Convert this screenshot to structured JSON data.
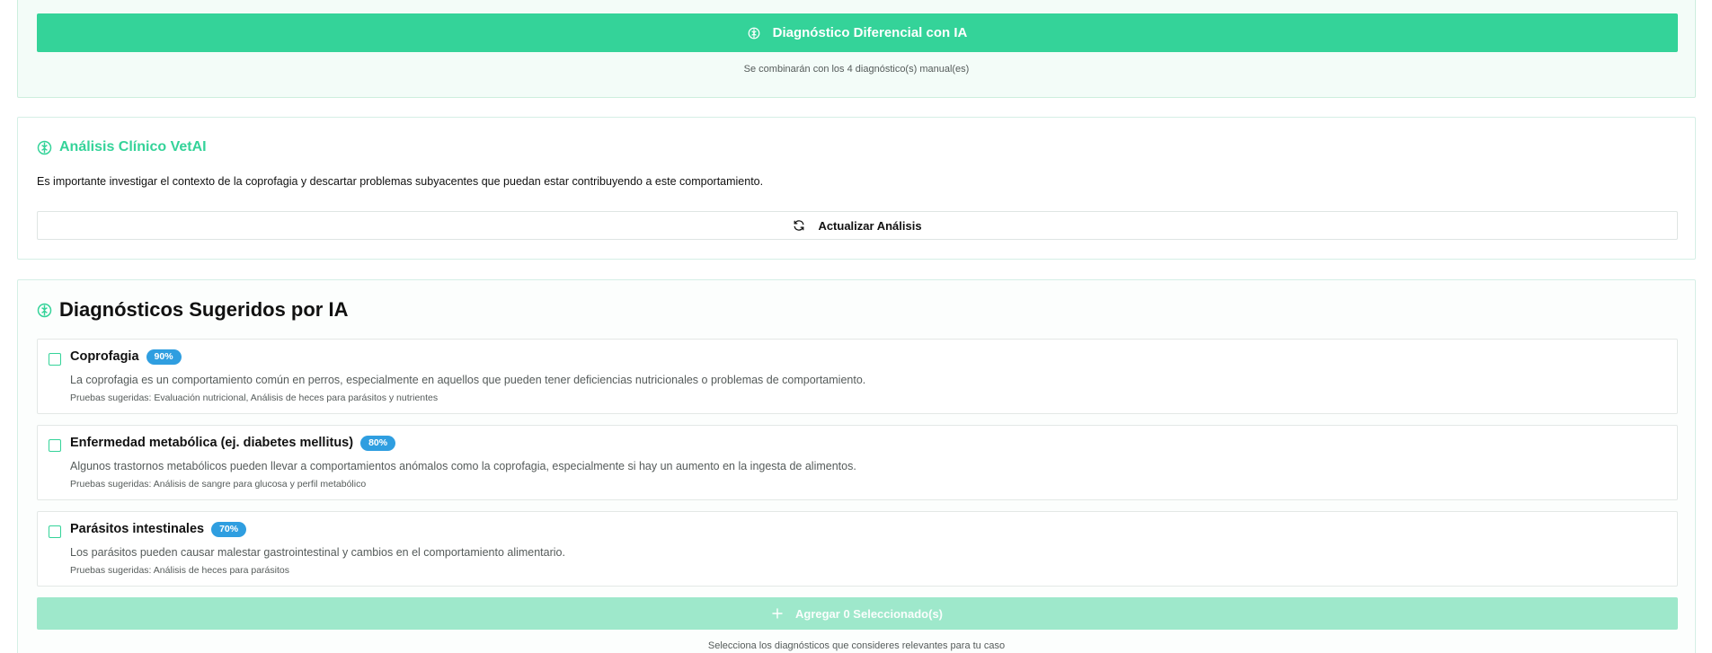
{
  "differential": {
    "button_label": "Diagnóstico Diferencial con IA",
    "hint": "Se combinarán con los 4 diagnóstico(s) manual(es)"
  },
  "analysis": {
    "title": "Análisis Clínico VetAI",
    "text": "Es importante investigar el contexto de la coprofagia y descartar problemas subyacentes que puedan estar contribuyendo a este comportamiento.",
    "update_label": "Actualizar Análisis"
  },
  "suggestions": {
    "title": "Diagnósticos Sugeridos por IA",
    "items": [
      {
        "name": "Coprofagia",
        "confidence": "90%",
        "description": "La coprofagia es un comportamiento común en perros, especialmente en aquellos que pueden tener deficiencias nutricionales o problemas de comportamiento.",
        "tests": "Pruebas sugeridas: Evaluación nutricional, Análisis de heces para parásitos y nutrientes",
        "checked": false
      },
      {
        "name": "Enfermedad metabólica (ej. diabetes mellitus)",
        "confidence": "80%",
        "description": "Algunos trastornos metabólicos pueden llevar a comportamientos anómalos como la coprofagia, especialmente si hay un aumento en la ingesta de alimentos.",
        "tests": "Pruebas sugeridas: Análisis de sangre para glucosa y perfil metabólico",
        "checked": false
      },
      {
        "name": "Parásitos intestinales",
        "confidence": "70%",
        "description": "Los parásitos pueden causar malestar gastrointestinal y cambios en el comportamiento alimentario.",
        "tests": "Pruebas sugeridas: Análisis de heces para parásitos",
        "checked": false
      }
    ],
    "add_label": "Agregar 0 Seleccionado(s)",
    "hint": "Selecciona los diagnósticos que consideres relevantes para tu caso"
  },
  "colors": {
    "accent": "#34d399",
    "badge": "#2f9ee0",
    "disabled_button": "#9ee8cb"
  },
  "icons": {
    "brain": "brain-icon",
    "refresh": "refresh-icon",
    "plus": "plus-icon"
  }
}
